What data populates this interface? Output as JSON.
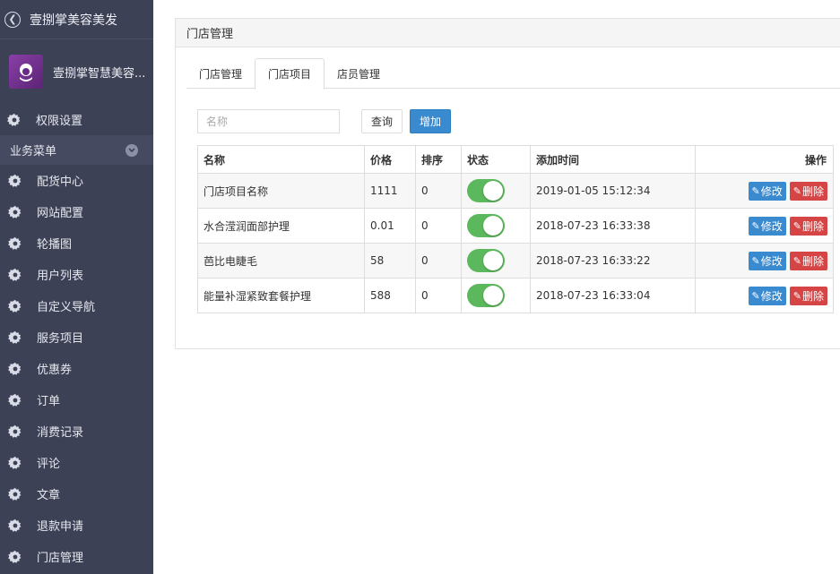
{
  "sidebar": {
    "top_title": "壹捌掌美容美发",
    "brand_name": "壹捌掌智慧美容...",
    "permission_label": "权限设置",
    "section_label": "业务菜单",
    "items": [
      {
        "label": "配货中心"
      },
      {
        "label": "网站配置"
      },
      {
        "label": "轮播图"
      },
      {
        "label": "用户列表"
      },
      {
        "label": "自定义导航"
      },
      {
        "label": "服务项目"
      },
      {
        "label": "优惠券"
      },
      {
        "label": "订单"
      },
      {
        "label": "消费记录"
      },
      {
        "label": "评论"
      },
      {
        "label": "文章"
      },
      {
        "label": "退款申请"
      },
      {
        "label": "门店管理"
      }
    ]
  },
  "panel": {
    "title": "门店管理",
    "tabs": [
      {
        "label": "门店管理",
        "active": false
      },
      {
        "label": "门店项目",
        "active": true
      },
      {
        "label": "店员管理",
        "active": false
      }
    ],
    "search_placeholder": "名称",
    "search_value": "",
    "query_button": "查询",
    "add_button": "增加"
  },
  "table": {
    "headers": {
      "name": "名称",
      "price": "价格",
      "sort": "排序",
      "status": "状态",
      "added_time": "添加时间",
      "actions": "操作"
    },
    "edit_label": "修改",
    "delete_label": "删除",
    "rows": [
      {
        "name": "门店项目名称",
        "price": "1111",
        "sort": "0",
        "status": true,
        "added_time": "2019-01-05 15:12:34"
      },
      {
        "name": "水合滢润面部护理",
        "price": "0.01",
        "sort": "0",
        "status": true,
        "added_time": "2018-07-23 16:33:38"
      },
      {
        "name": "芭比电睫毛",
        "price": "58",
        "sort": "0",
        "status": true,
        "added_time": "2018-07-23 16:33:22"
      },
      {
        "name": "能量补湿紧致套餐护理",
        "price": "588",
        "sort": "0",
        "status": true,
        "added_time": "2018-07-23 16:33:04"
      }
    ]
  },
  "colors": {
    "sidebar_bg": "#3d4156",
    "primary": "#3a8ad0",
    "danger": "#d64545",
    "toggle_on": "#5cb85c"
  }
}
